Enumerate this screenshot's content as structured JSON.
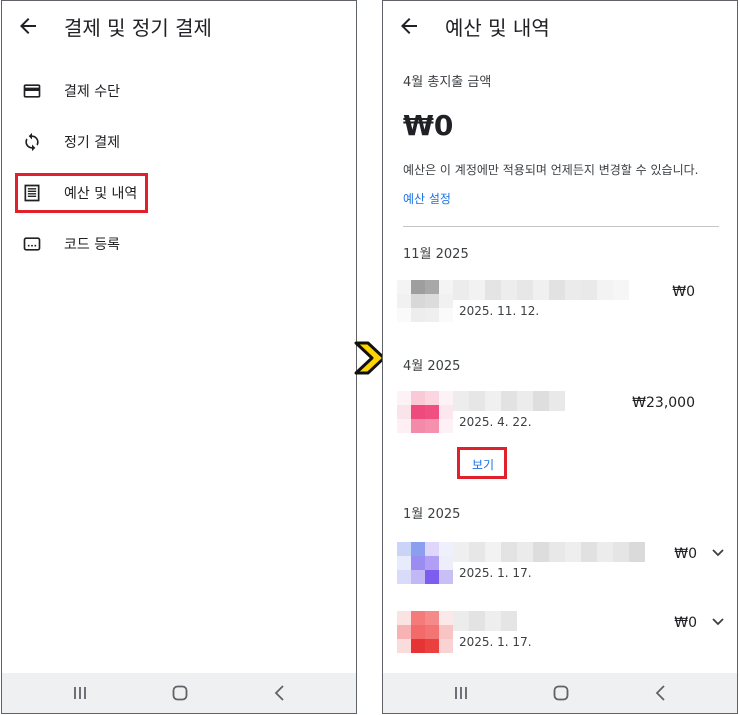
{
  "left": {
    "title": "결제 및 정기 결제",
    "menu": [
      {
        "label": "결제 수단",
        "icon": "credit-card-icon"
      },
      {
        "label": "정기 결제",
        "icon": "sync-icon"
      },
      {
        "label": "예산 및 내역",
        "icon": "receipt-list-icon"
      },
      {
        "label": "코드 등록",
        "icon": "redeem-code-icon"
      }
    ]
  },
  "right": {
    "title": "예산 및 내역",
    "spend_label": "4월 총지출 금액",
    "spend_amount": "₩0",
    "budget_note": "예산은 이 계정에만 적용되며 언제든지 변경할 수 있습니다.",
    "budget_link": "예산 설정",
    "sections": [
      {
        "label": "11월 2025",
        "items": [
          {
            "date": "2025. 11. 12.",
            "amount": "₩0"
          }
        ]
      },
      {
        "label": "4월 2025",
        "items": [
          {
            "date": "2025. 4. 22.",
            "amount": "₩23,000",
            "action": "보기"
          }
        ]
      },
      {
        "label": "1월 2025",
        "items": [
          {
            "date": "2025. 1. 17.",
            "amount": "₩0"
          },
          {
            "date": "2025. 1. 17.",
            "amount": "₩0"
          }
        ]
      }
    ]
  },
  "colors": {
    "highlight": "#e0202a",
    "link": "#1a73e8",
    "navbar": "#eef0f2",
    "arrow": "#ffd400"
  }
}
